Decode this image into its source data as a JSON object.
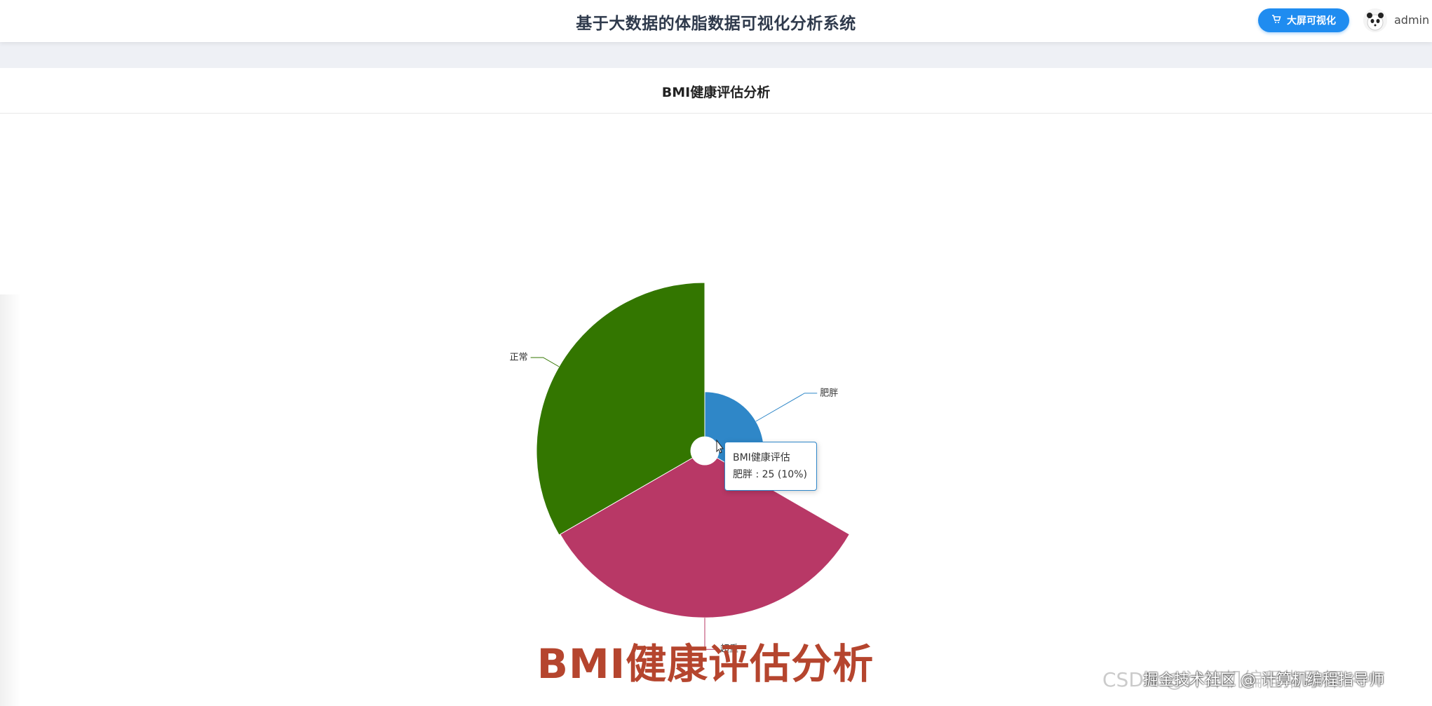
{
  "header": {
    "app_title": "基于大数据的体脂数据可视化分析系统",
    "bigscreen_label": "大屏可视化",
    "username": "admin"
  },
  "card": {
    "title": "BMI健康评估分析"
  },
  "tooltip": {
    "title": "BMI健康评估",
    "line": "肥胖 : 25 (10%)"
  },
  "caption": "BMI健康评估分析",
  "watermark": {
    "back": "CSDN @计算机编程指导师",
    "front": "掘金技术社区 @ 计算机编程指导师"
  },
  "colors": {
    "primary_button": "#1f8cf0",
    "caption": "#b5452e"
  },
  "chart_data": {
    "type": "pie",
    "subtype": "nightingale-rose",
    "series_name": "BMI健康评估",
    "categories": [
      "肥胖",
      "超重",
      "正常"
    ],
    "values": [
      25,
      112,
      113
    ],
    "percent": [
      10,
      45,
      45
    ],
    "colors": [
      "#2f87c8",
      "#b83866",
      "#337600"
    ],
    "highlighted": "肥胖"
  }
}
